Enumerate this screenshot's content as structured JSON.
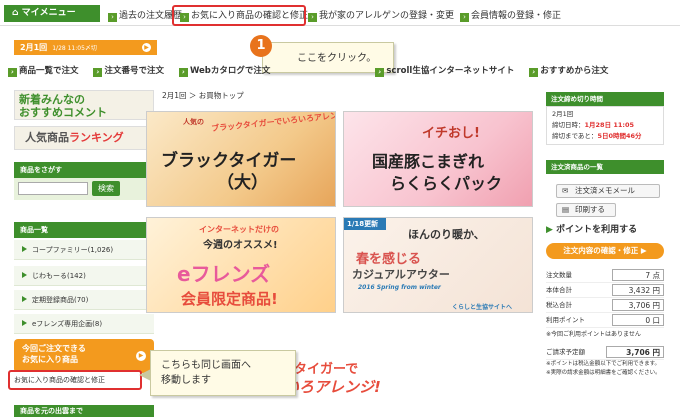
{
  "topnav": {
    "mymenu_label": "マイメニュー",
    "links": [
      "過去の注文履歴",
      "お気に入り商品の確認と修正",
      "我が家のアレルゲンの登録・変更",
      "会員情報の登録・修正"
    ]
  },
  "datebar": {
    "label": "2月1回",
    "sub": "1/28 11:05〆切"
  },
  "callout1": {
    "number": "1",
    "text": "ここをクリック。"
  },
  "row2": {
    "links": [
      "商品一覧で注文",
      "注文番号で注文",
      "Webカタログで注文",
      "scroll生協インターネットサイト",
      "おすすめから注文"
    ]
  },
  "sidebar": {
    "banner1_line1": "新着みんなの",
    "banner1_line2": "おすすめコメント",
    "banner2_prefix": "人気商品",
    "banner2_suffix": "ランキング",
    "search_title": "商品をさがす",
    "search_button": "検索",
    "category_title": "商品一覧",
    "categories": [
      "コープファミリー(1,026)",
      "じわもーる(142)",
      "定期登録商品(70)",
      "eフレンズ専用企画(8)"
    ],
    "fav_box_line1": "今回ご注文できる",
    "fav_box_line2": "お気に入り商品",
    "fav_link": "お気に入り商品の確認と修正",
    "bottom_title": "商品を元の出雲まで"
  },
  "callout2": {
    "line1": "こちらも同じ画面へ",
    "line2": "移動します"
  },
  "breadcrumb": "2月1回 ＞ お買物トップ",
  "banners": {
    "b1_tag": "人気の",
    "b1_small": "ブラックタイガーでいろいろアレンジ!",
    "b1_main": "ブラックタイガー",
    "b1_sub": "（大）",
    "b2_tag": "イチおし!",
    "b2_main": "国産豚こまぎれ",
    "b2_sub": "らくらくパック",
    "b3_tag": "インターネットだけの",
    "b3_sub1": "今週のオススメ!",
    "b3_main": "eフレンズ",
    "b3_sub2": "会員限定商品!",
    "b4_tag": "1/18更新",
    "b4_l1": "ほんのり暖か、",
    "b4_l2": "春を感じる",
    "b4_l3": "カジュアルアウター",
    "b4_note": "2016 Spring from winter",
    "b4_footer": "くらしと生協サイトへ",
    "b5_l1": "タイガーで",
    "b5_l2": "いろアレンジ!"
  },
  "rightpanel": {
    "deadline_title": "注文締め切り時間",
    "deadline_round": "2月1回",
    "deadline_time_label": "締切日時：",
    "deadline_time": "1月28日 11:05",
    "deadline_left_label": "締切まであと：",
    "deadline_left": "5日0時間46分",
    "order_title": "注文済商品の一覧",
    "memo_button": "注文済メモメール",
    "print_button": "印刷する",
    "points_line": "ポイントを利用する",
    "confirm_button": "注文内容の確認・修正",
    "summary": [
      {
        "label": "注文数量",
        "value": "7 点"
      },
      {
        "label": "本体合計",
        "value": "3,432 円"
      },
      {
        "label": "税込合計",
        "value": "3,706 円"
      },
      {
        "label": "利用ポイント",
        "value": "0 口"
      }
    ],
    "note1": "※今回ご利用ポイントはありません",
    "final_label": "ご請求予定額",
    "final_value": "3,706 円",
    "note2": "※ポイントは税込金額以下でご利用できます。",
    "note3": "※実際の請求金額は明細書をご確認ください。"
  },
  "colors": {
    "green": "#3e8f2c",
    "orange": "#f39a1e",
    "red": "#e03030"
  }
}
